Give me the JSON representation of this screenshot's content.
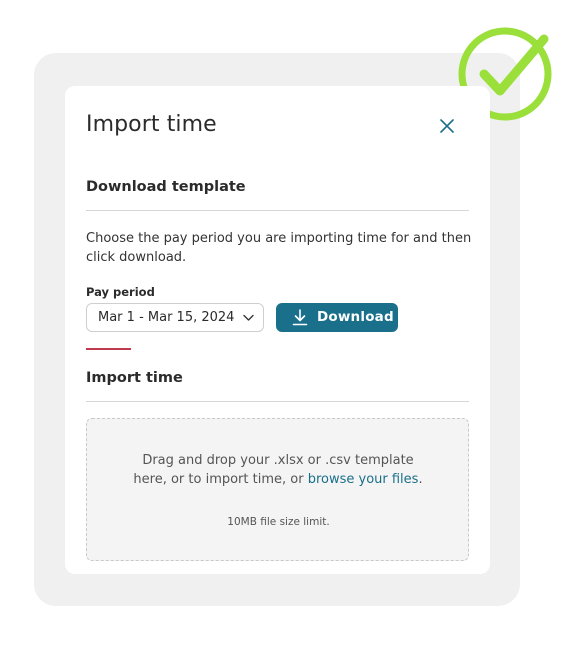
{
  "dialog": {
    "title": "Import time",
    "close_icon": "close-icon"
  },
  "download_section": {
    "heading": "Download template",
    "description": "Choose the pay period you are importing time for and then click download.",
    "pay_period_label": "Pay period",
    "pay_period_value": "Mar 1 - Mar 15, 2024",
    "download_label": "Download",
    "download_icon": "download-icon"
  },
  "import_section": {
    "heading": "Import time",
    "drop_text_prefix": "Drag and drop your .xlsx or .csv template here, or to import time, or ",
    "browse_link": "browse your files",
    "drop_text_suffix": ".",
    "size_limit": "10MB file size limit."
  },
  "colors": {
    "accent": "#1a6f8a",
    "check_badge": "#9adf3a",
    "accent_underline": "#c0394e"
  }
}
